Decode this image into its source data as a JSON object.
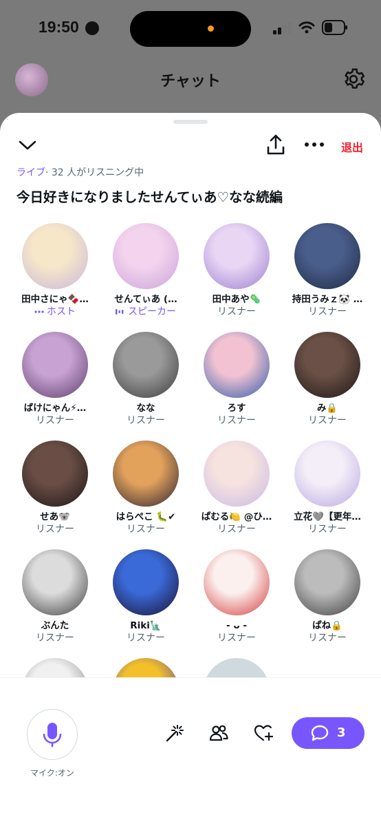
{
  "status_bar": {
    "time": "19:50"
  },
  "header": {
    "title": "チャット"
  },
  "sheet": {
    "leave_label": "退出",
    "live_label": "ライブ",
    "listener_text": "· 32 人がリスニング中",
    "space_title": "今日好きになりましたせんてぃあ♡なな続編"
  },
  "members": [
    {
      "name": "田中さにゃ🍫…",
      "role": "ホスト",
      "role_type": "host",
      "palette": [
        "#f6e7c8",
        "#c9b6d9"
      ]
    },
    {
      "name": "せんてぃあ (…",
      "role": "スピーカー",
      "role_type": "speaker",
      "palette": [
        "#f4d3ee",
        "#c9a3d8"
      ]
    },
    {
      "name": "田中あや🦠",
      "role": "リスナー",
      "role_type": "listener",
      "palette": [
        "#e8d6f4",
        "#9b7fd0"
      ]
    },
    {
      "name": "持田うみｚ🐼 …",
      "role": "リスナー",
      "role_type": "listener",
      "palette": [
        "#4a5e8c",
        "#1f2a44"
      ]
    },
    {
      "name": "ばけにゃん⚡…",
      "role": "リスナー",
      "role_type": "listener",
      "palette": [
        "#c8a2d2",
        "#5a3d6c"
      ]
    },
    {
      "name": "なな",
      "role": "リスナー",
      "role_type": "listener",
      "palette": [
        "#9a9a9a",
        "#3a3a3a"
      ]
    },
    {
      "name": "ろす",
      "role": "リスナー",
      "role_type": "listener",
      "palette": [
        "#f2c2d2",
        "#2b5ba8"
      ]
    },
    {
      "name": "み🔒",
      "role": "リスナー",
      "role_type": "listener",
      "palette": [
        "#6a5046",
        "#1e1614"
      ]
    },
    {
      "name": "せあ🐨",
      "role": "リスナー",
      "role_type": "listener",
      "palette": [
        "#6a4e46",
        "#1c1414"
      ]
    },
    {
      "name": "はらぺこ 🐛✔",
      "role": "リスナー",
      "role_type": "listener",
      "palette": [
        "#e2a25c",
        "#2a2130"
      ]
    },
    {
      "name": "ぱむる🍋 @ひ…",
      "role": "リスナー",
      "role_type": "listener",
      "palette": [
        "#f6e2de",
        "#c8b8e6"
      ]
    },
    {
      "name": "立花🩶【更年…",
      "role": "リスナー",
      "role_type": "listener",
      "palette": [
        "#f4eef8",
        "#b8a8e2"
      ]
    },
    {
      "name": "ぶんた",
      "role": "リスナー",
      "role_type": "listener",
      "palette": [
        "#dcdcdc",
        "#3a3a3a"
      ]
    },
    {
      "name": "Riki🗽",
      "role": "リスナー",
      "role_type": "listener",
      "palette": [
        "#3a6ad8",
        "#1a1030"
      ]
    },
    {
      "name": "- ᴗ -",
      "role": "リスナー",
      "role_type": "listener",
      "palette": [
        "#fbf0ee",
        "#d23a3a"
      ]
    },
    {
      "name": "ぱね🔒",
      "role": "リスナー",
      "role_type": "listener",
      "palette": [
        "#bcbcbc",
        "#3c3c3c"
      ]
    },
    {
      "name": "",
      "role": "",
      "role_type": "listener",
      "palette": [
        "#f0f0f0",
        "#7a7a7a"
      ]
    },
    {
      "name": "",
      "role": "",
      "role_type": "listener",
      "palette": [
        "#f3c02a",
        "#4b2ea6"
      ]
    },
    {
      "name": "",
      "role": "",
      "role_type": "listener",
      "palette": [
        "#cfd9de",
        "#cfd9de"
      ]
    }
  ],
  "bottom_bar": {
    "mic_label": "マイク:オン",
    "chat_count": "3"
  },
  "colors": {
    "accent": "#7856ff",
    "leave": "#f4212e",
    "secondary_text": "#536471"
  },
  "icons": [
    "globe-icon",
    "signal-icon",
    "wifi-icon",
    "battery-icon",
    "gear-icon",
    "chevron-down-icon",
    "share-icon",
    "more-icon",
    "mic-icon",
    "magic-wand-icon",
    "people-icon",
    "heart-plus-icon",
    "chat-bubble-icon"
  ]
}
